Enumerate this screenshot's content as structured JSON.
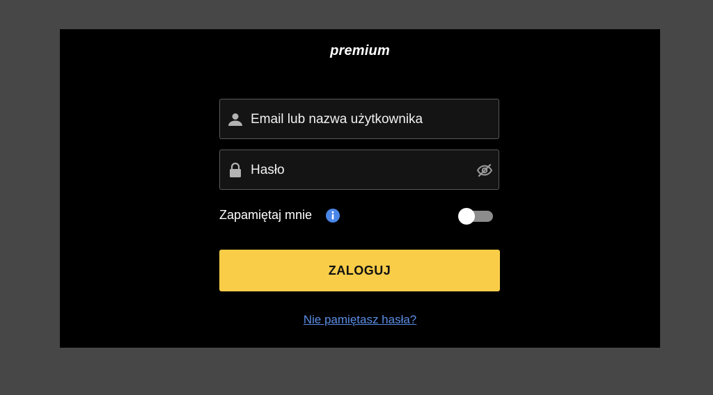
{
  "brand": {
    "logo_text": "premium"
  },
  "login_form": {
    "email_placeholder": "Email lub nazwa użytkownika",
    "email_value": "",
    "password_placeholder": "Hasło",
    "password_value": "",
    "remember_label": "Zapamiętaj mnie",
    "remember_enabled": false,
    "submit_label": "ZALOGUJ",
    "forgot_link": "Nie pamiętasz hasła?"
  },
  "icons": {
    "email": "user-icon",
    "password": "lock-icon",
    "show_password": "eye-slash-icon",
    "info": "info-icon"
  },
  "colors": {
    "background": "#474747",
    "panel": "#000000",
    "field_background": "#141414",
    "field_border": "#5a5a5a",
    "accent": "#f9cd48",
    "link": "#5b8ee6",
    "info": "#4a86e8",
    "toggle_track": "#8c8c8c"
  }
}
